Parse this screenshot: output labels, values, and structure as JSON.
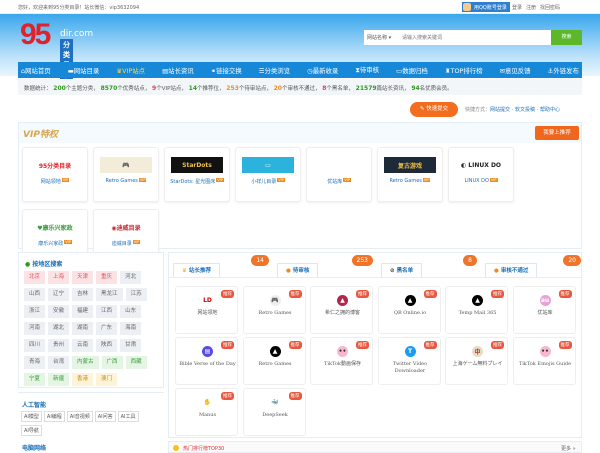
{
  "topbar": {
    "welcome": "您好，欢迎来到95分类目录！站长微信：vip3632094",
    "qq_login": "用QQ账号登录",
    "login": "登录",
    "register": "注册",
    "find_password": "找回密码"
  },
  "logo": {
    "number": "95",
    "domain": "dir.com",
    "subtitle": "分类目录"
  },
  "search": {
    "category": "网站名称 ▾",
    "placeholder": "请输入搜索关键词",
    "button": "搜索"
  },
  "nav": [
    {
      "icon": "home-icon",
      "glyph": "⌂",
      "label": "网站首页"
    },
    {
      "icon": "folder-icon",
      "glyph": "▬",
      "label": "网站目录"
    },
    {
      "icon": "crown-icon",
      "glyph": "♛",
      "label": "VIP站点"
    },
    {
      "icon": "news-icon",
      "glyph": "▤",
      "label": "站长资讯"
    },
    {
      "icon": "link-icon",
      "glyph": "⚭",
      "label": "链接交换"
    },
    {
      "icon": "list-icon",
      "glyph": "☰",
      "label": "分类浏览"
    },
    {
      "icon": "clock-icon",
      "glyph": "◷",
      "label": "最新收录"
    },
    {
      "icon": "hourglass-icon",
      "glyph": "⧗",
      "label": "待审核"
    },
    {
      "icon": "archive-icon",
      "glyph": "▭",
      "label": "数据归档"
    },
    {
      "icon": "trophy-icon",
      "glyph": "♜",
      "label": "TOP排行榜"
    },
    {
      "icon": "comments-icon",
      "glyph": "✉",
      "label": "意见反馈"
    },
    {
      "icon": "anchor-icon",
      "glyph": "⚓",
      "label": "外链发布"
    }
  ],
  "stats": {
    "prefix": "数据统计：",
    "categories": "200",
    "categories_label": "个主题分类，",
    "sites": "8570",
    "sites_label": "个优秀站点，",
    "vip": "9",
    "vip_label": "个VIP站点，",
    "recommended": "14",
    "recommended_label": "个推荐位，",
    "pending": "253",
    "pending_label": "个待审站点，",
    "rejected": "20",
    "rejected_label": "个审核不通过，",
    "blacklist": "8",
    "blacklist_label": "个黑名单，",
    "articles": "21579",
    "articles_label": "篇站长资讯，",
    "members": "94",
    "members_label": "名优质会员。"
  },
  "quick": {
    "button": "✎ 快速提交",
    "label": "快捷方式：",
    "links": [
      "网站提交",
      "软文投稿",
      "帮助中心"
    ]
  },
  "vip": {
    "title": "VIP特权",
    "recommend_button": "我要上推荐",
    "badge": "VIP",
    "sites": [
      {
        "name": "网站领地",
        "logo": "95分类目录",
        "bg": "#fff",
        "color": "#e0222a"
      },
      {
        "name": "Retro Games",
        "logo": "🎮",
        "bg": "#f3ecd8",
        "color": "#444"
      },
      {
        "name": "StarDots: 星光图床",
        "logo": "StarDots",
        "bg": "#111",
        "color": "#e8c04a"
      },
      {
        "name": "小祥儿目录",
        "logo": "▭",
        "bg": "#2bb3dd",
        "color": "#fff"
      },
      {
        "name": "优站库",
        "logo": "",
        "bg": "#fff",
        "color": "#444"
      },
      {
        "name": "Retro Games",
        "logo": "复古游戏",
        "bg": "#1d2a3a",
        "color": "#f0c040"
      },
      {
        "name": "LINUX DO",
        "logo": "◐ LINUX DO",
        "bg": "#fff",
        "color": "#222"
      },
      {
        "name": "康乐兴家政",
        "logo": "♥康乐兴家政",
        "bg": "#fff",
        "color": "#3a9b3a"
      },
      {
        "name": "迪威目录",
        "logo": "◉迪威目录",
        "bg": "#fff",
        "color": "#c0282f"
      }
    ]
  },
  "regions": {
    "title": "按地区搜索",
    "items": [
      {
        "n": "北京",
        "c": "red"
      },
      {
        "n": "上海",
        "c": "red"
      },
      {
        "n": "天津",
        "c": "red"
      },
      {
        "n": "重庆",
        "c": "red"
      },
      {
        "n": "河北",
        "c": ""
      },
      {
        "n": "山西",
        "c": ""
      },
      {
        "n": "辽宁",
        "c": ""
      },
      {
        "n": "吉林",
        "c": ""
      },
      {
        "n": "黑龙江",
        "c": ""
      },
      {
        "n": "江苏",
        "c": ""
      },
      {
        "n": "浙江",
        "c": ""
      },
      {
        "n": "安徽",
        "c": ""
      },
      {
        "n": "福建",
        "c": ""
      },
      {
        "n": "江西",
        "c": ""
      },
      {
        "n": "山东",
        "c": ""
      },
      {
        "n": "河南",
        "c": ""
      },
      {
        "n": "湖北",
        "c": ""
      },
      {
        "n": "湖南",
        "c": ""
      },
      {
        "n": "广东",
        "c": ""
      },
      {
        "n": "海南",
        "c": ""
      },
      {
        "n": "四川",
        "c": ""
      },
      {
        "n": "贵州",
        "c": ""
      },
      {
        "n": "云南",
        "c": ""
      },
      {
        "n": "陕西",
        "c": ""
      },
      {
        "n": "甘肃",
        "c": ""
      },
      {
        "n": "青海",
        "c": ""
      },
      {
        "n": "台湾",
        "c": ""
      },
      {
        "n": "内蒙古",
        "c": "green"
      },
      {
        "n": "广西",
        "c": "green"
      },
      {
        "n": "西藏",
        "c": "green"
      },
      {
        "n": "宁夏",
        "c": "green"
      },
      {
        "n": "新疆",
        "c": "green"
      },
      {
        "n": "香港",
        "c": "yellow"
      },
      {
        "n": "澳门",
        "c": "yellow"
      }
    ]
  },
  "ai": {
    "title": "人工智能",
    "tags": [
      "AI模型",
      "AI编程",
      "AI音视频",
      "AI问答",
      "AI工具",
      "AI导航"
    ],
    "next_title": "电脑网络"
  },
  "tabs": [
    {
      "label": "站长推荐",
      "icon": "crown-icon",
      "glyph": "♛",
      "count": "14"
    },
    {
      "label": "待审核",
      "icon": "clock-icon",
      "glyph": "●",
      "count": "253"
    },
    {
      "label": "黑名单",
      "icon": "ban-icon",
      "glyph": "⊘",
      "count": "8"
    },
    {
      "label": "审核不通过",
      "icon": "warning-icon",
      "glyph": "●",
      "count": "20"
    }
  ],
  "recommended": {
    "badge": "推荐",
    "sites": [
      {
        "name": "网站领地",
        "glyph": "LD",
        "bg": "#fff",
        "color": "#c00"
      },
      {
        "name": "Retro Games",
        "glyph": "🎮",
        "bg": "#eee",
        "color": "#444"
      },
      {
        "name": "希仁之拥的博客",
        "glyph": "▲",
        "bg": "#b8254a",
        "color": "#fff"
      },
      {
        "name": "QB Online.io",
        "glyph": "▲",
        "bg": "#000",
        "color": "#fff"
      },
      {
        "name": "Temp Mail 365",
        "glyph": "▲",
        "bg": "#000",
        "color": "#fff"
      },
      {
        "name": "优站库",
        "glyph": "au",
        "bg": "#e7a3d8",
        "color": "#fff"
      },
      {
        "name": "Bible Verse of the Day",
        "glyph": "▤",
        "bg": "#5a4be0",
        "color": "#fff"
      },
      {
        "name": "Retro Games",
        "glyph": "▲",
        "bg": "#000",
        "color": "#fff"
      },
      {
        "name": "TikTok動画保存",
        "glyph": "••",
        "bg": "#f7b8cc",
        "color": "#333"
      },
      {
        "name": "Twitter Video Downloader",
        "glyph": "T",
        "bg": "#1d9bf0",
        "color": "#fff"
      },
      {
        "name": "上海ゲーム無料プレイ",
        "glyph": "中",
        "bg": "#e9dcc5",
        "color": "#a33"
      },
      {
        "name": "TikTok Emojis Guide",
        "glyph": "••",
        "bg": "#f7b8cc",
        "color": "#333"
      },
      {
        "name": "Manus",
        "glyph": "✋",
        "bg": "#fff",
        "color": "#333"
      },
      {
        "name": "DeepSeek",
        "glyph": "🐳",
        "bg": "#fff",
        "color": "#4d6bfe"
      }
    ]
  },
  "hot": {
    "title": "热门排行榜TOP30",
    "more": "更多 »"
  }
}
